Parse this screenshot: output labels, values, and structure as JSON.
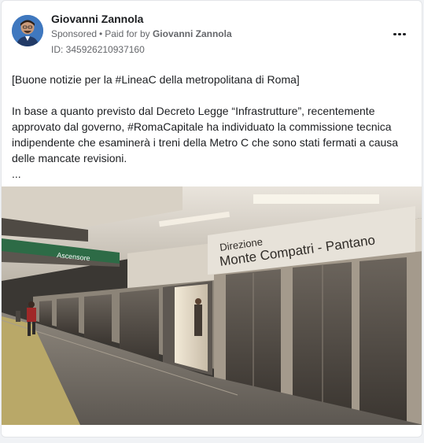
{
  "post": {
    "author": "Giovanni Zannola",
    "sponsored": "Sponsored",
    "separator": "•",
    "paid_for_prefix": "Paid for by",
    "paid_for_name": "Giovanni Zannola",
    "ad_id": "ID: 345926210937160",
    "text_line_1": "[Buone notizie per la #LineaC della metropolitana di Roma]",
    "text_para_2": "In base a quanto previsto dal Decreto Legge “Infrastrutture”, recentemente approvato dal governo, #RomaCapitale ha individuato la commissione tecnica indipendente che esaminerà i treni della Metro C che sono stati fermati a causa delle mancate revisioni.",
    "text_ellipsis": "...",
    "more_icon": "more-horizontal-icon"
  },
  "photo": {
    "sign_line_1": "Direzione",
    "sign_line_2": "Monte Compatri - Pantano",
    "sign_ascensore": "Ascensore"
  }
}
